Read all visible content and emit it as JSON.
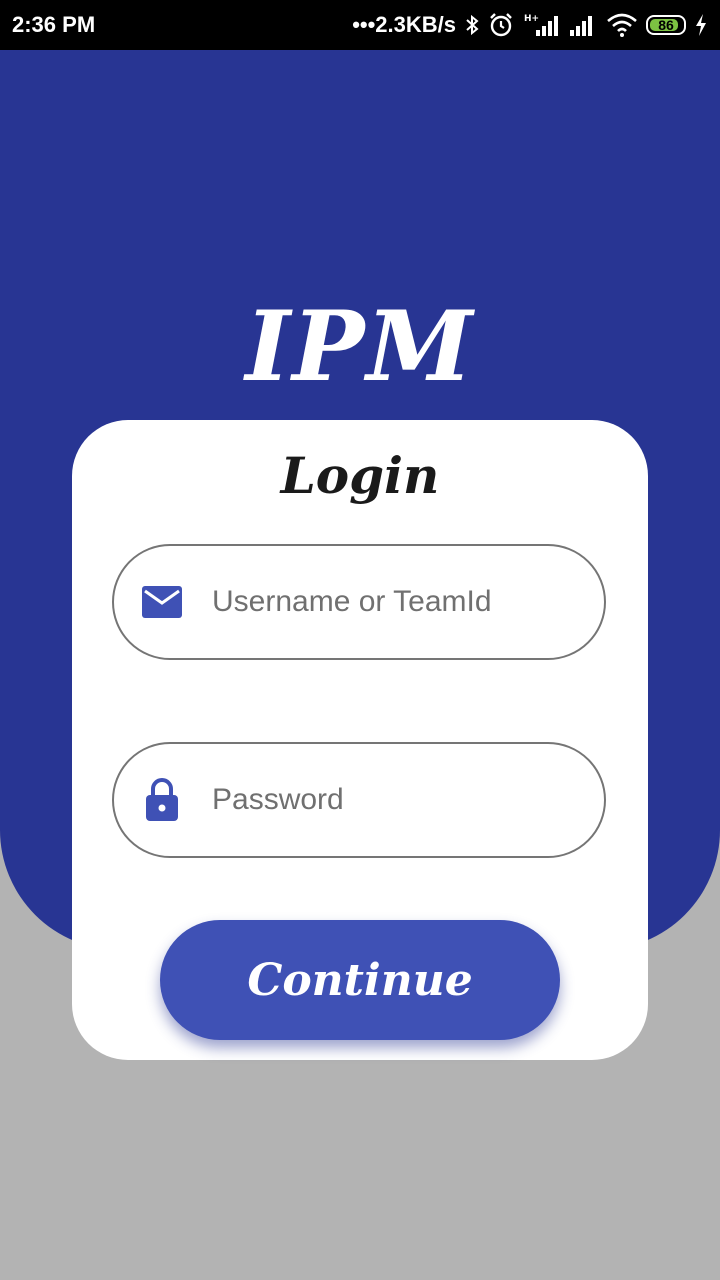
{
  "status_bar": {
    "time": "2:36 PM",
    "network_speed": "•••2.3KB/s",
    "battery_level": "86",
    "battery_fraction": 0.86,
    "icons": [
      "bluetooth-icon",
      "alarm-icon",
      "signal-hplus-icon",
      "signal-icon",
      "wifi-icon",
      "battery-icon",
      "charging-icon"
    ]
  },
  "app": {
    "title": "IPM"
  },
  "login_card": {
    "title": "Login",
    "username_field": {
      "placeholder": "Username or TeamId",
      "value": "",
      "icon": "mail-icon"
    },
    "password_field": {
      "placeholder": "Password",
      "value": "",
      "icon": "lock-icon"
    },
    "continue_label": "Continue"
  },
  "colors": {
    "primary_dark": "#283593",
    "primary": "#3f51b5",
    "background": "#b3b3b3",
    "card": "#ffffff"
  }
}
